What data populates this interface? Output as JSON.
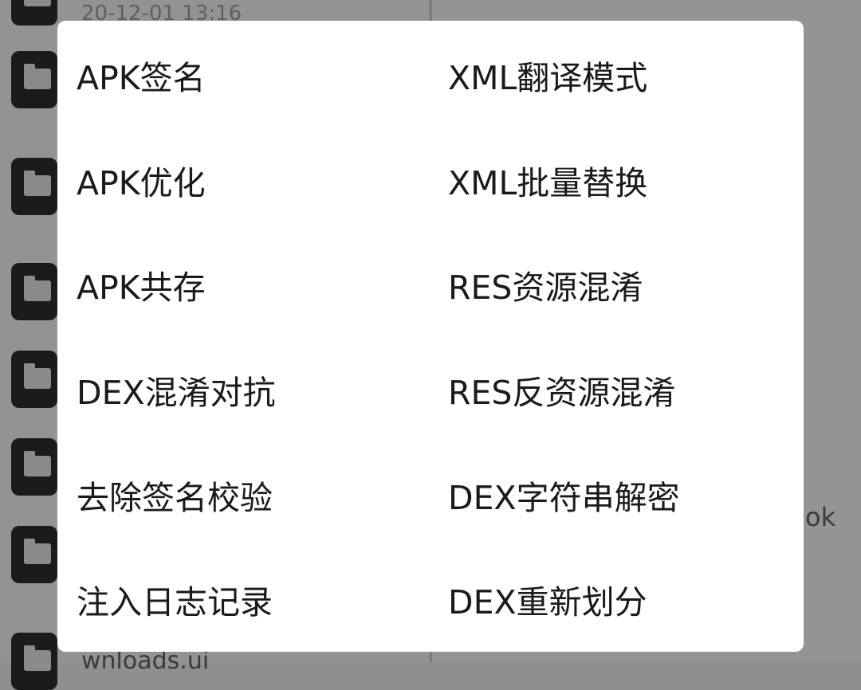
{
  "background": {
    "rows": [
      {
        "text": "20-12-01 13:16"
      },
      {
        "text": "wnloads.ui"
      }
    ],
    "right_fragment": "ok"
  },
  "dialog": {
    "left_items": [
      {
        "label": "APK签名"
      },
      {
        "label": "APK优化"
      },
      {
        "label": "APK共存"
      },
      {
        "label": "DEX混淆对抗"
      },
      {
        "label": "去除签名校验"
      },
      {
        "label": "注入日志记录"
      }
    ],
    "right_items": [
      {
        "label": "XML翻译模式"
      },
      {
        "label": "XML批量替换"
      },
      {
        "label": "RES资源混淆"
      },
      {
        "label": "RES反资源混淆"
      },
      {
        "label": "DEX字符串解密"
      },
      {
        "label": "DEX重新划分"
      }
    ]
  }
}
